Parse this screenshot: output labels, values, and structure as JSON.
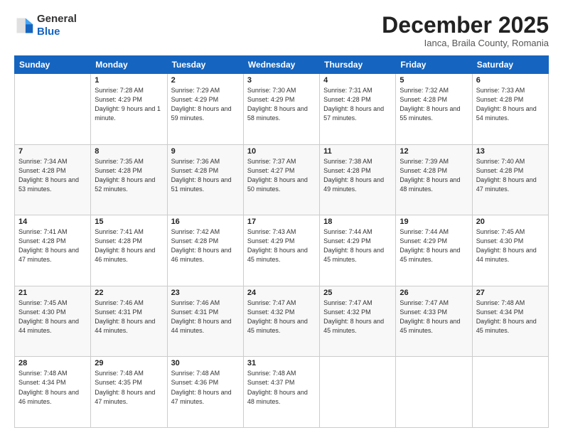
{
  "logo": {
    "general": "General",
    "blue": "Blue"
  },
  "header": {
    "month": "December 2025",
    "location": "Ianca, Braila County, Romania"
  },
  "weekdays": [
    "Sunday",
    "Monday",
    "Tuesday",
    "Wednesday",
    "Thursday",
    "Friday",
    "Saturday"
  ],
  "weeks": [
    [
      {
        "day": "",
        "info": ""
      },
      {
        "day": "1",
        "info": "Sunrise: 7:28 AM\nSunset: 4:29 PM\nDaylight: 9 hours\nand 1 minute."
      },
      {
        "day": "2",
        "info": "Sunrise: 7:29 AM\nSunset: 4:29 PM\nDaylight: 8 hours\nand 59 minutes."
      },
      {
        "day": "3",
        "info": "Sunrise: 7:30 AM\nSunset: 4:29 PM\nDaylight: 8 hours\nand 58 minutes."
      },
      {
        "day": "4",
        "info": "Sunrise: 7:31 AM\nSunset: 4:28 PM\nDaylight: 8 hours\nand 57 minutes."
      },
      {
        "day": "5",
        "info": "Sunrise: 7:32 AM\nSunset: 4:28 PM\nDaylight: 8 hours\nand 55 minutes."
      },
      {
        "day": "6",
        "info": "Sunrise: 7:33 AM\nSunset: 4:28 PM\nDaylight: 8 hours\nand 54 minutes."
      }
    ],
    [
      {
        "day": "7",
        "info": "Sunrise: 7:34 AM\nSunset: 4:28 PM\nDaylight: 8 hours\nand 53 minutes."
      },
      {
        "day": "8",
        "info": "Sunrise: 7:35 AM\nSunset: 4:28 PM\nDaylight: 8 hours\nand 52 minutes."
      },
      {
        "day": "9",
        "info": "Sunrise: 7:36 AM\nSunset: 4:28 PM\nDaylight: 8 hours\nand 51 minutes."
      },
      {
        "day": "10",
        "info": "Sunrise: 7:37 AM\nSunset: 4:27 PM\nDaylight: 8 hours\nand 50 minutes."
      },
      {
        "day": "11",
        "info": "Sunrise: 7:38 AM\nSunset: 4:28 PM\nDaylight: 8 hours\nand 49 minutes."
      },
      {
        "day": "12",
        "info": "Sunrise: 7:39 AM\nSunset: 4:28 PM\nDaylight: 8 hours\nand 48 minutes."
      },
      {
        "day": "13",
        "info": "Sunrise: 7:40 AM\nSunset: 4:28 PM\nDaylight: 8 hours\nand 47 minutes."
      }
    ],
    [
      {
        "day": "14",
        "info": "Sunrise: 7:41 AM\nSunset: 4:28 PM\nDaylight: 8 hours\nand 47 minutes."
      },
      {
        "day": "15",
        "info": "Sunrise: 7:41 AM\nSunset: 4:28 PM\nDaylight: 8 hours\nand 46 minutes."
      },
      {
        "day": "16",
        "info": "Sunrise: 7:42 AM\nSunset: 4:28 PM\nDaylight: 8 hours\nand 46 minutes."
      },
      {
        "day": "17",
        "info": "Sunrise: 7:43 AM\nSunset: 4:29 PM\nDaylight: 8 hours\nand 45 minutes."
      },
      {
        "day": "18",
        "info": "Sunrise: 7:44 AM\nSunset: 4:29 PM\nDaylight: 8 hours\nand 45 minutes."
      },
      {
        "day": "19",
        "info": "Sunrise: 7:44 AM\nSunset: 4:29 PM\nDaylight: 8 hours\nand 45 minutes."
      },
      {
        "day": "20",
        "info": "Sunrise: 7:45 AM\nSunset: 4:30 PM\nDaylight: 8 hours\nand 44 minutes."
      }
    ],
    [
      {
        "day": "21",
        "info": "Sunrise: 7:45 AM\nSunset: 4:30 PM\nDaylight: 8 hours\nand 44 minutes."
      },
      {
        "day": "22",
        "info": "Sunrise: 7:46 AM\nSunset: 4:31 PM\nDaylight: 8 hours\nand 44 minutes."
      },
      {
        "day": "23",
        "info": "Sunrise: 7:46 AM\nSunset: 4:31 PM\nDaylight: 8 hours\nand 44 minutes."
      },
      {
        "day": "24",
        "info": "Sunrise: 7:47 AM\nSunset: 4:32 PM\nDaylight: 8 hours\nand 45 minutes."
      },
      {
        "day": "25",
        "info": "Sunrise: 7:47 AM\nSunset: 4:32 PM\nDaylight: 8 hours\nand 45 minutes."
      },
      {
        "day": "26",
        "info": "Sunrise: 7:47 AM\nSunset: 4:33 PM\nDaylight: 8 hours\nand 45 minutes."
      },
      {
        "day": "27",
        "info": "Sunrise: 7:48 AM\nSunset: 4:34 PM\nDaylight: 8 hours\nand 45 minutes."
      }
    ],
    [
      {
        "day": "28",
        "info": "Sunrise: 7:48 AM\nSunset: 4:34 PM\nDaylight: 8 hours\nand 46 minutes."
      },
      {
        "day": "29",
        "info": "Sunrise: 7:48 AM\nSunset: 4:35 PM\nDaylight: 8 hours\nand 47 minutes."
      },
      {
        "day": "30",
        "info": "Sunrise: 7:48 AM\nSunset: 4:36 PM\nDaylight: 8 hours\nand 47 minutes."
      },
      {
        "day": "31",
        "info": "Sunrise: 7:48 AM\nSunset: 4:37 PM\nDaylight: 8 hours\nand 48 minutes."
      },
      {
        "day": "",
        "info": ""
      },
      {
        "day": "",
        "info": ""
      },
      {
        "day": "",
        "info": ""
      }
    ]
  ]
}
